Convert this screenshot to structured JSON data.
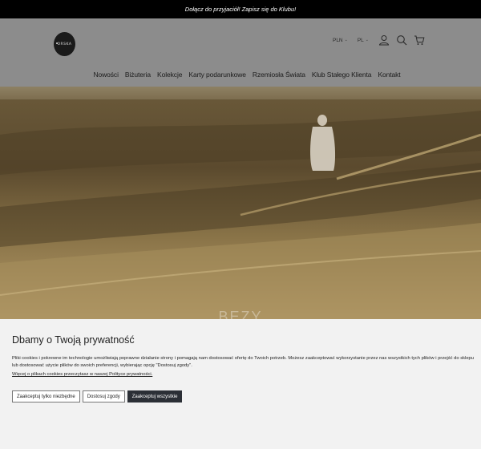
{
  "topbar": {
    "text": "Dołącz do przyjaciół! Zapisz się do Klubu!"
  },
  "header": {
    "logo_text": "ORSKA",
    "currency": "PLN",
    "language": "PL"
  },
  "nav": {
    "items": [
      "Nowości",
      "Biżuteria",
      "Kolekcje",
      "Karty podarunkowe",
      "Rzemiosła Świata",
      "Klub Stałego Klienta",
      "Kontakt"
    ]
  },
  "hero": {
    "caption": "BEZY"
  },
  "cookie": {
    "title": "Dbamy o Twoją prywatność",
    "body": "Pliki cookies i pokrewne im technologie umożliwiają poprawne działanie strony i pomagają nam dostosować ofertę do Twoich potrzeb. Możesz zaakceptować wykorzystanie przez nas wszystkich tych plików i przejść do sklepu lub dostosować użycie plików do swoich preferencji, wybierając opcję \"Dostosuj zgody\".",
    "link": "Więcej o plikach cookies przeczytasz w naszej Polityce prywatności.",
    "btn_necessary": "Zaakceptuj tylko niezbędne",
    "btn_customize": "Dostosuj zgody",
    "btn_accept_all": "Zaakceptuj wszystkie"
  },
  "colors": {
    "header_bg": "#8c8c8c",
    "topbar_bg": "#000000",
    "dark_button": "#2b2f36"
  }
}
